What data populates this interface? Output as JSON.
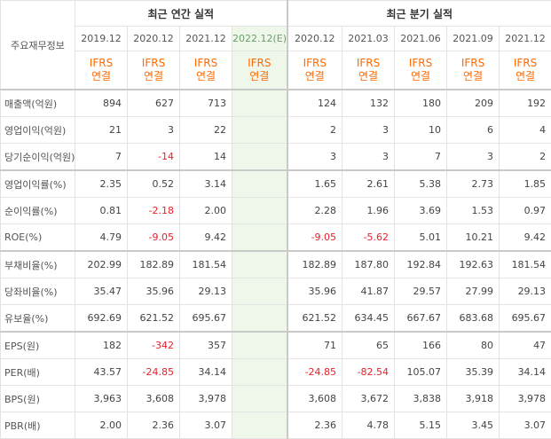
{
  "header": {
    "row_label": "주요재무정보",
    "annual_title": "최근 연간 실적",
    "quarterly_title": "최근 분기 실적",
    "annual_periods": [
      "2019.12",
      "2020.12",
      "2021.12",
      "2022.12(E)"
    ],
    "quarterly_periods": [
      "2020.12",
      "2021.03",
      "2021.06",
      "2021.09",
      "2021.12"
    ],
    "ifrs_label": "IFRS",
    "basis_label": "연결"
  },
  "rows": [
    {
      "label": "매출액(억원)",
      "annual": [
        "894",
        "627",
        "713",
        ""
      ],
      "quarterly": [
        "124",
        "132",
        "180",
        "209",
        "192"
      ]
    },
    {
      "label": "영업이익(억원)",
      "annual": [
        "21",
        "3",
        "22",
        ""
      ],
      "quarterly": [
        "2",
        "3",
        "10",
        "6",
        "4"
      ]
    },
    {
      "label": "당기순이익(억원)",
      "annual": [
        "7",
        "-14",
        "14",
        ""
      ],
      "quarterly": [
        "3",
        "3",
        "7",
        "3",
        "2"
      ]
    },
    {
      "label": "영업이익률(%)",
      "annual": [
        "2.35",
        "0.52",
        "3.14",
        ""
      ],
      "quarterly": [
        "1.65",
        "2.61",
        "5.38",
        "2.73",
        "1.85"
      ]
    },
    {
      "label": "순이익률(%)",
      "annual": [
        "0.81",
        "-2.18",
        "2.00",
        ""
      ],
      "quarterly": [
        "2.28",
        "1.96",
        "3.69",
        "1.53",
        "0.97"
      ]
    },
    {
      "label": "ROE(%)",
      "annual": [
        "4.79",
        "-9.05",
        "9.42",
        ""
      ],
      "quarterly": [
        "-9.05",
        "-5.62",
        "5.01",
        "10.21",
        "9.42"
      ]
    },
    {
      "label": "부채비율(%)",
      "annual": [
        "202.99",
        "182.89",
        "181.54",
        ""
      ],
      "quarterly": [
        "182.89",
        "187.80",
        "192.84",
        "192.63",
        "181.54"
      ]
    },
    {
      "label": "당좌비율(%)",
      "annual": [
        "35.47",
        "35.96",
        "29.13",
        ""
      ],
      "quarterly": [
        "35.96",
        "41.87",
        "29.57",
        "27.99",
        "29.13"
      ]
    },
    {
      "label": "유보율(%)",
      "annual": [
        "692.69",
        "621.52",
        "695.67",
        ""
      ],
      "quarterly": [
        "621.52",
        "634.45",
        "667.67",
        "683.68",
        "695.67"
      ]
    },
    {
      "label": "EPS(원)",
      "annual": [
        "182",
        "-342",
        "357",
        ""
      ],
      "quarterly": [
        "71",
        "65",
        "166",
        "80",
        "47"
      ]
    },
    {
      "label": "PER(배)",
      "annual": [
        "43.57",
        "-24.85",
        "34.14",
        ""
      ],
      "quarterly": [
        "-24.85",
        "-82.54",
        "105.07",
        "35.39",
        "34.14"
      ]
    },
    {
      "label": "BPS(원)",
      "annual": [
        "3,963",
        "3,608",
        "3,978",
        ""
      ],
      "quarterly": [
        "3,608",
        "3,672",
        "3,838",
        "3,918",
        "3,978"
      ]
    },
    {
      "label": "PBR(배)",
      "annual": [
        "2.00",
        "2.36",
        "3.07",
        ""
      ],
      "quarterly": [
        "2.36",
        "4.78",
        "5.15",
        "3.45",
        "3.07"
      ]
    }
  ],
  "colors": {
    "ifrs": "#ff6a00",
    "negative": "#e8212b",
    "estimate_bg": "#eef7ea"
  }
}
